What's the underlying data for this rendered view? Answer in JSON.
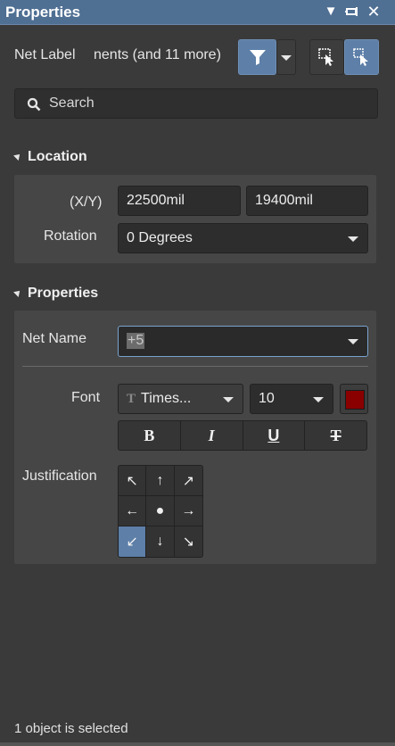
{
  "titlebar": {
    "title": "Properties",
    "icons": [
      "dropdown-triangle-icon",
      "pin-icon",
      "close-icon"
    ]
  },
  "header": {
    "object_type": "Net Label",
    "components_text": "nents (and 11 more)",
    "filter_icon": "filter-icon",
    "select_icons": [
      "select-include-icon",
      "select-pointer-icon"
    ]
  },
  "search": {
    "placeholder": "Search"
  },
  "location": {
    "heading": "Location",
    "xy_label": "(X/Y)",
    "x_value": "22500mil",
    "y_value": "19400mil",
    "rotation_label": "Rotation",
    "rotation_value": "0 Degrees"
  },
  "properties": {
    "heading": "Properties",
    "net_name_label": "Net Name",
    "net_name_value": "+5",
    "font_label": "Font",
    "font_name": "Times...",
    "font_size": "10",
    "font_color": "#8a0000",
    "format_buttons": [
      "B",
      "I",
      "U",
      "T"
    ],
    "justification_label": "Justification",
    "justification_arrows": [
      "↖",
      "↑",
      "↗",
      "←",
      "●",
      "→",
      "↙",
      "↓",
      "↘"
    ],
    "justification_selected": "bottom-left"
  },
  "status": {
    "text": "1 object is selected"
  },
  "colors": {
    "accent": "#5d7fa8",
    "titlebar": "#4f6f93",
    "background": "#3a3a3a"
  }
}
